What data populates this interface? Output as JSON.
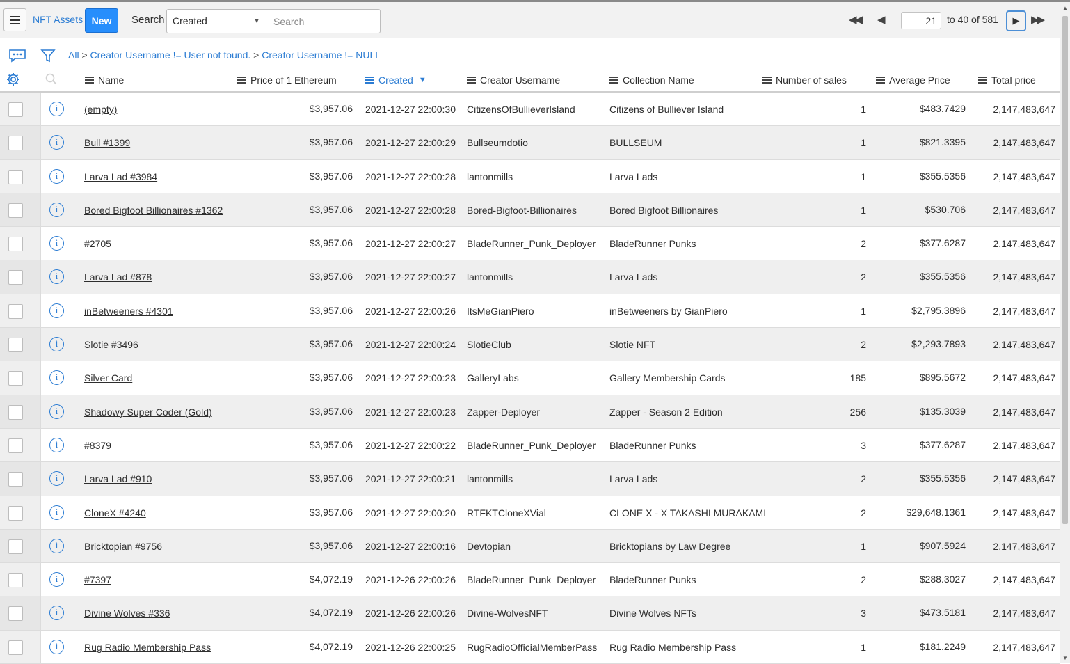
{
  "header": {
    "list_title": "NFT Assets",
    "new_label": "New",
    "search_label": "Search",
    "search_field": "Created",
    "search_placeholder": "Search",
    "page_number": "21",
    "range_text": "to 40 of 581"
  },
  "breadcrumb": {
    "all": "All",
    "sep": ">",
    "filter1": "Creator Username != User not found.",
    "filter2": "Creator Username != NULL"
  },
  "columns": {
    "name": "Name",
    "price_eth": "Price of 1 Ethereum",
    "created": "Created",
    "creator": "Creator Username",
    "collection": "Collection Name",
    "sales": "Number of sales",
    "avg_price": "Average Price",
    "total_price": "Total price"
  },
  "icons": {
    "menu": "menu-icon",
    "first": "first-page-icon",
    "prev": "prev-page-icon",
    "next": "next-page-icon",
    "last": "last-page-icon",
    "comments": "comments-icon",
    "filter": "filter-icon",
    "settings": "gear-icon",
    "search": "search-icon",
    "info": "info-icon"
  },
  "colors": {
    "accent": "#2b7cd3",
    "new_button": "#278efc"
  },
  "rows": [
    {
      "name": "(empty)",
      "price": "$3,957.06",
      "created": "2021-12-27 22:00:30",
      "creator": "CitizensOfBullieverIsland",
      "collection": "Citizens of Bulliever Island",
      "sales": "1",
      "avg": "$483.7429",
      "total": "2,147,483,647"
    },
    {
      "name": "Bull #1399",
      "price": "$3,957.06",
      "created": "2021-12-27 22:00:29",
      "creator": "Bullseumdotio",
      "collection": "BULLSEUM",
      "sales": "1",
      "avg": "$821.3395",
      "total": "2,147,483,647"
    },
    {
      "name": "Larva Lad #3984",
      "price": "$3,957.06",
      "created": "2021-12-27 22:00:28",
      "creator": "lantonmills",
      "collection": "Larva Lads",
      "sales": "1",
      "avg": "$355.5356",
      "total": "2,147,483,647"
    },
    {
      "name": "Bored Bigfoot Billionaires #1362",
      "price": "$3,957.06",
      "created": "2021-12-27 22:00:28",
      "creator": "Bored-Bigfoot-Billionaires",
      "collection": "Bored Bigfoot Billionaires",
      "sales": "1",
      "avg": "$530.706",
      "total": "2,147,483,647"
    },
    {
      "name": "#2705",
      "price": "$3,957.06",
      "created": "2021-12-27 22:00:27",
      "creator": "BladeRunner_Punk_Deployer",
      "collection": "BladeRunner Punks",
      "sales": "2",
      "avg": "$377.6287",
      "total": "2,147,483,647"
    },
    {
      "name": "Larva Lad #878",
      "price": "$3,957.06",
      "created": "2021-12-27 22:00:27",
      "creator": "lantonmills",
      "collection": "Larva Lads",
      "sales": "2",
      "avg": "$355.5356",
      "total": "2,147,483,647"
    },
    {
      "name": "inBetweeners #4301",
      "price": "$3,957.06",
      "created": "2021-12-27 22:00:26",
      "creator": "ItsMeGianPiero",
      "collection": "inBetweeners by GianPiero",
      "sales": "1",
      "avg": "$2,795.3896",
      "total": "2,147,483,647"
    },
    {
      "name": "Slotie #3496",
      "price": "$3,957.06",
      "created": "2021-12-27 22:00:24",
      "creator": "SlotieClub",
      "collection": "Slotie NFT",
      "sales": "2",
      "avg": "$2,293.7893",
      "total": "2,147,483,647"
    },
    {
      "name": "Silver Card",
      "price": "$3,957.06",
      "created": "2021-12-27 22:00:23",
      "creator": "GalleryLabs",
      "collection": "Gallery Membership Cards",
      "sales": "185",
      "avg": "$895.5672",
      "total": "2,147,483,647"
    },
    {
      "name": "Shadowy Super Coder (Gold)",
      "price": "$3,957.06",
      "created": "2021-12-27 22:00:23",
      "creator": "Zapper-Deployer",
      "collection": "Zapper - Season 2 Edition",
      "sales": "256",
      "avg": "$135.3039",
      "total": "2,147,483,647"
    },
    {
      "name": "#8379",
      "price": "$3,957.06",
      "created": "2021-12-27 22:00:22",
      "creator": "BladeRunner_Punk_Deployer",
      "collection": "BladeRunner Punks",
      "sales": "3",
      "avg": "$377.6287",
      "total": "2,147,483,647"
    },
    {
      "name": "Larva Lad #910",
      "price": "$3,957.06",
      "created": "2021-12-27 22:00:21",
      "creator": "lantonmills",
      "collection": "Larva Lads",
      "sales": "2",
      "avg": "$355.5356",
      "total": "2,147,483,647"
    },
    {
      "name": "CloneX #4240",
      "price": "$3,957.06",
      "created": "2021-12-27 22:00:20",
      "creator": "RTFKTCloneXVial",
      "collection": "CLONE X - X TAKASHI MURAKAMI",
      "sales": "2",
      "avg": "$29,648.1361",
      "total": "2,147,483,647"
    },
    {
      "name": "Bricktopian #9756",
      "price": "$3,957.06",
      "created": "2021-12-27 22:00:16",
      "creator": "Devtopian",
      "collection": "Bricktopians by Law Degree",
      "sales": "1",
      "avg": "$907.5924",
      "total": "2,147,483,647"
    },
    {
      "name": "#7397",
      "price": "$4,072.19",
      "created": "2021-12-26 22:00:26",
      "creator": "BladeRunner_Punk_Deployer",
      "collection": "BladeRunner Punks",
      "sales": "2",
      "avg": "$288.3027",
      "total": "2,147,483,647"
    },
    {
      "name": "Divine Wolves #336",
      "price": "$4,072.19",
      "created": "2021-12-26 22:00:26",
      "creator": "Divine-WolvesNFT",
      "collection": "Divine Wolves NFTs",
      "sales": "3",
      "avg": "$473.5181",
      "total": "2,147,483,647"
    },
    {
      "name": "Rug Radio Membership Pass",
      "price": "$4,072.19",
      "created": "2021-12-26 22:00:25",
      "creator": "RugRadioOfficialMemberPass",
      "collection": "Rug Radio Membership Pass",
      "sales": "1",
      "avg": "$181.2249",
      "total": "2,147,483,647"
    }
  ]
}
